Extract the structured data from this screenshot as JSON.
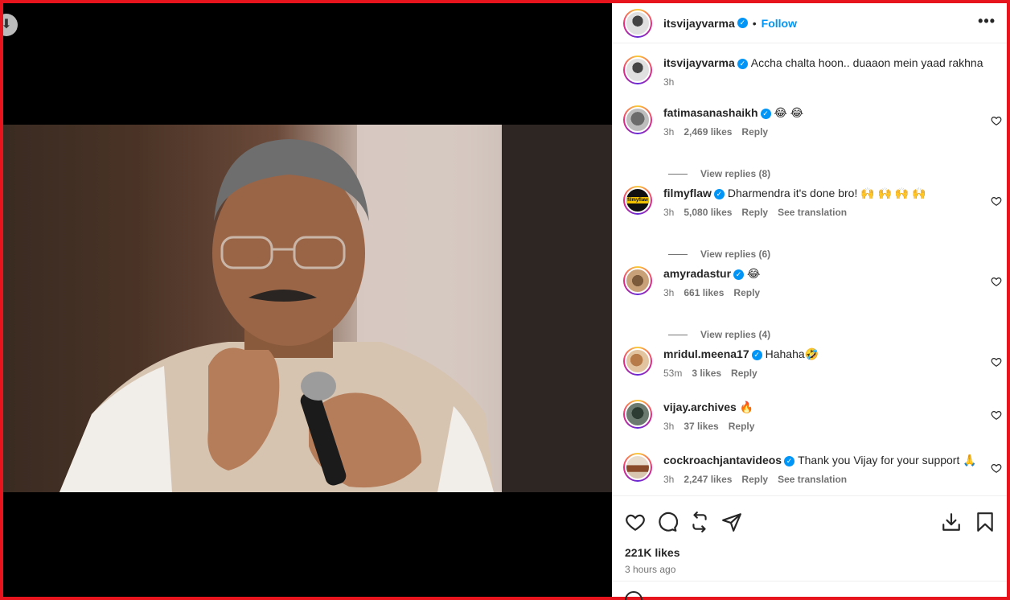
{
  "post": {
    "author": "itsvijayvarma",
    "follow_label": "Follow",
    "separator": "•",
    "more_label": "•••",
    "caption": {
      "user": "itsvijayvarma",
      "text": "Accha chalta hoon.. duaaon mein yaad rakhna",
      "time": "3h"
    },
    "likes": "221K likes",
    "posted_ago": "3 hours ago"
  },
  "comments": [
    {
      "user": "fatimasanashaikh",
      "verified": true,
      "text": "😂 😂",
      "time": "3h",
      "likes": "2,469 likes",
      "reply": "Reply",
      "translate": "",
      "replies": "View replies (8)"
    },
    {
      "user": "filmyflaw",
      "verified": true,
      "text": "Dharmendra it's done bro! 🙌 🙌 🙌 🙌",
      "time": "3h",
      "likes": "5,080 likes",
      "reply": "Reply",
      "translate": "See translation",
      "replies": "View replies (6)"
    },
    {
      "user": "amyradastur",
      "verified": true,
      "text": "😂",
      "time": "3h",
      "likes": "661 likes",
      "reply": "Reply",
      "translate": "",
      "replies": "View replies (4)"
    },
    {
      "user": "mridul.meena17",
      "verified": true,
      "text": "Hahaha🤣",
      "time": "53m",
      "likes": "3 likes",
      "reply": "Reply",
      "translate": "",
      "replies": ""
    },
    {
      "user": "vijay.archives",
      "verified": false,
      "text": "🔥",
      "time": "3h",
      "likes": "37 likes",
      "reply": "Reply",
      "translate": "",
      "replies": ""
    },
    {
      "user": "cockroachjantavideos",
      "verified": true,
      "text": "Thank you Vijay for your support 🙏",
      "time": "3h",
      "likes": "2,247 likes",
      "reply": "Reply",
      "translate": "See translation",
      "replies": ""
    }
  ],
  "avatar_badge": "filmyflaw",
  "icons": {
    "like": "heart-icon",
    "comment": "comment-icon",
    "repost": "repost-icon",
    "share": "send-icon",
    "download": "download-icon",
    "save": "bookmark-icon",
    "media_side": "down-arrow-icon"
  },
  "colors": {
    "accent": "#0095f6",
    "frame": "#e8141d"
  }
}
